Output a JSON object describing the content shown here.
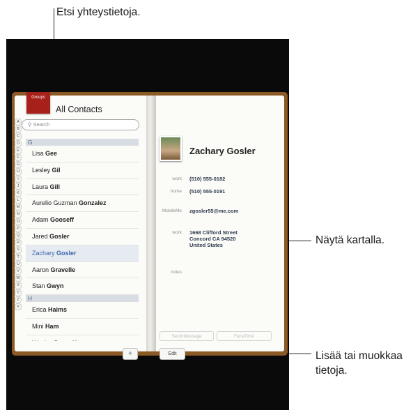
{
  "callouts": {
    "search": "Etsi yhteystietoja.",
    "map": "Näytä kartalla.",
    "edit_line1": "Lisää tai muokkaa",
    "edit_line2": "tietoja."
  },
  "left_page": {
    "groups_label": "Groups",
    "title": "All Contacts",
    "search_placeholder": "Search",
    "index": [
      "A",
      "B",
      "C",
      "D",
      "E",
      "F",
      "G",
      "H",
      "I",
      "J",
      "K",
      "L",
      "M",
      "N",
      "O",
      "P",
      "Q",
      "R",
      "S",
      "T",
      "U",
      "V",
      "W",
      "X",
      "Y",
      "Z",
      "#"
    ],
    "sections": [
      {
        "letter": "G",
        "rows": [
          {
            "first": "Lisa",
            "last": "Gee"
          },
          {
            "first": "Lesley",
            "last": "Gil"
          },
          {
            "first": "Laura",
            "last": "Gill"
          },
          {
            "first": "Aurelio Guzman",
            "last": "Gonzalez"
          },
          {
            "first": "Adam",
            "last": "Gooseff"
          },
          {
            "first": "Jared",
            "last": "Gosler"
          },
          {
            "first": "Zachary",
            "last": "Gosler"
          },
          {
            "first": "Aaron",
            "last": "Gravelle"
          },
          {
            "first": "Stan",
            "last": "Gwyn"
          }
        ]
      },
      {
        "letter": "H",
        "rows": [
          {
            "first": "Erica",
            "last": "Haims"
          },
          {
            "first": "Mini",
            "last": "Ham"
          },
          {
            "first": "Wesley Bryan",
            "last": "Hamm"
          }
        ]
      }
    ],
    "selected_row": "Zachary Gosler",
    "add_label": "+"
  },
  "right_page": {
    "name": "Zachary Gosler",
    "fields": {
      "work_phone_label": "work",
      "work_phone": "(510) 555-0182",
      "home_phone_label": "home",
      "home_phone": "(510) 555-0191",
      "email_label": "MobileMe",
      "email": "zgosler55@me.com",
      "address_label": "work",
      "address_line1": "1668 Clifford Street",
      "address_line2": "Concord CA 94520",
      "address_line3": "United States",
      "notes_label": "notes"
    },
    "send_message_label": "Send Message",
    "facetime_label": "FaceTime",
    "edit_label": "Edit"
  }
}
